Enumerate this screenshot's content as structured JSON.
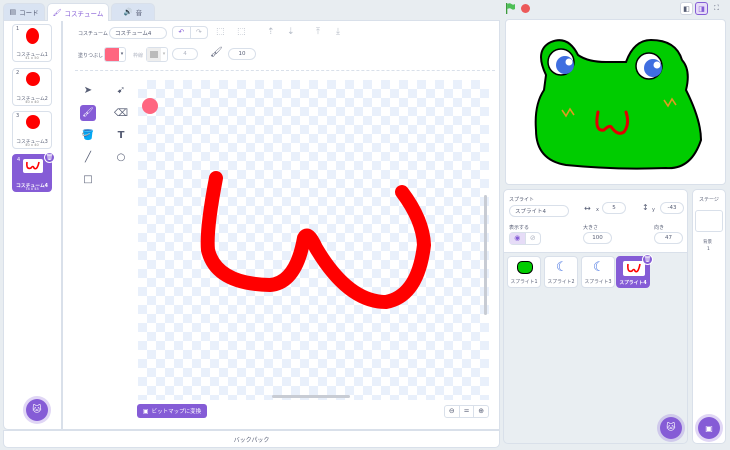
{
  "tabs": {
    "code": "コード",
    "costumes": "コスチューム",
    "sounds": "音"
  },
  "costume_list": [
    {
      "num": "1",
      "name": "コスチューム1",
      "size": "41 x 50"
    },
    {
      "num": "2",
      "name": "コスチューム2",
      "size": "40 x 40"
    },
    {
      "num": "3",
      "name": "コスチューム3",
      "size": "40 x 40"
    },
    {
      "num": "4",
      "name": "コスチューム4",
      "size": "74 x 45"
    }
  ],
  "editor": {
    "costume_label": "コスチューム",
    "costume_name": "コスチューム4",
    "fill_label": "塗りつぶし",
    "outline_label": "枠線",
    "outline_width": "4",
    "brush_size": "10",
    "convert_button": "ビットマップに変換",
    "zoom_reset": "="
  },
  "backpack": {
    "label": "バックパック"
  },
  "sprite_info": {
    "sprite_label": "スプライト",
    "sprite_name": "スプライト4",
    "x_label": "x",
    "x_value": "5",
    "y_label": "y",
    "y_value": "-43",
    "show_label": "表示する",
    "size_label": "大きさ",
    "size_value": "100",
    "direction_label": "向き",
    "direction_value": "47"
  },
  "sprites": [
    {
      "name": "スプライト1"
    },
    {
      "name": "スプライト2"
    },
    {
      "name": "スプライト3"
    },
    {
      "name": "スプライト4"
    }
  ],
  "stage_panel": {
    "title": "ステージ",
    "backdrops_label": "背景",
    "backdrops_count": "1"
  },
  "colors": {
    "accent": "#855cd6",
    "fill": "#ff6680",
    "paint": "#ff0000",
    "frog": "#00cc00"
  }
}
